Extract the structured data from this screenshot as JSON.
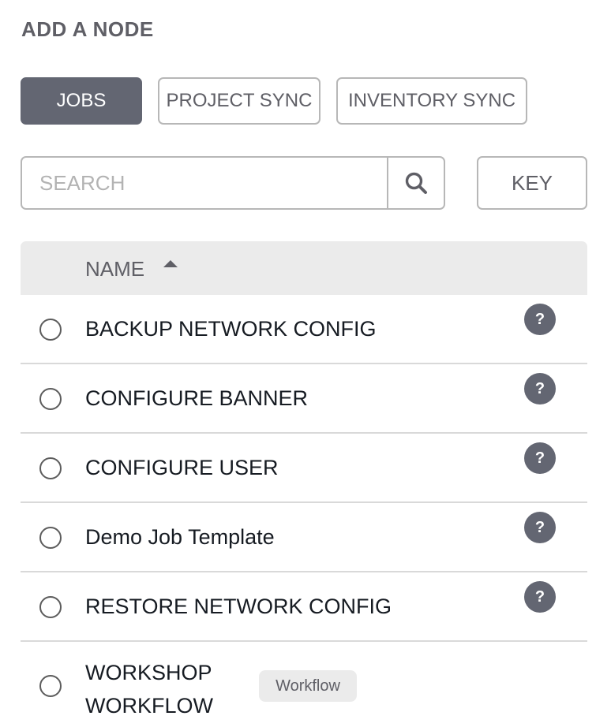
{
  "header": {
    "title": "ADD A NODE"
  },
  "tabs": [
    {
      "label": "JOBS",
      "active": true
    },
    {
      "label": "PROJECT SYNC",
      "active": false
    },
    {
      "label": "INVENTORY SYNC",
      "active": false
    }
  ],
  "search": {
    "placeholder": "SEARCH",
    "value": "",
    "icon": "search-icon"
  },
  "key_button": {
    "label": "KEY"
  },
  "table": {
    "column": {
      "label": "NAME",
      "sort": "ascending"
    },
    "rows": [
      {
        "name": "BACKUP NETWORK CONFIG",
        "help": "?",
        "selected": false
      },
      {
        "name": "CONFIGURE BANNER",
        "help": "?",
        "selected": false
      },
      {
        "name": "CONFIGURE USER",
        "help": "?",
        "selected": false
      },
      {
        "name": "Demo Job Template",
        "help": "?",
        "selected": false
      },
      {
        "name": "RESTORE NETWORK CONFIG",
        "help": "?",
        "selected": false
      },
      {
        "name": "WORKSHOP WORKFLOW",
        "badge": "Workflow",
        "selected": false
      }
    ]
  },
  "colors": {
    "accent": "#636672",
    "border": "#b7b7b7",
    "header_bg": "#ebebeb",
    "title": "#5f5f66"
  }
}
